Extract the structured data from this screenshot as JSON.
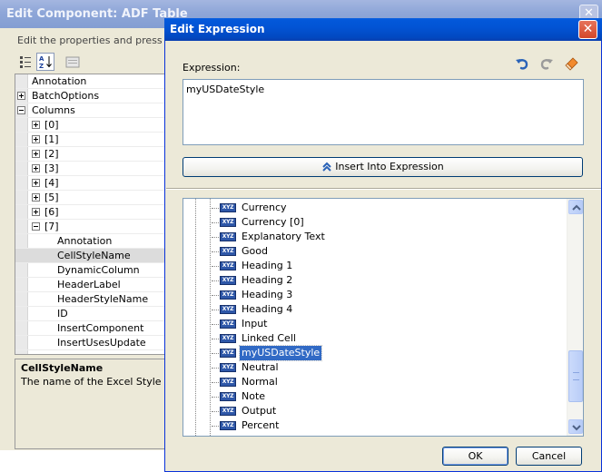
{
  "background_window": {
    "title": "Edit Component: ADF Table",
    "description": "Edit the properties and press OK to",
    "property_rows": [
      {
        "label": "Annotation",
        "indent": 0,
        "toggle": "none"
      },
      {
        "label": "BatchOptions",
        "indent": 0,
        "toggle": "plus"
      },
      {
        "label": "Columns",
        "indent": 0,
        "toggle": "minus"
      },
      {
        "label": "[0]",
        "indent": 1,
        "toggle": "plus"
      },
      {
        "label": "[1]",
        "indent": 1,
        "toggle": "plus"
      },
      {
        "label": "[2]",
        "indent": 1,
        "toggle": "plus"
      },
      {
        "label": "[3]",
        "indent": 1,
        "toggle": "plus"
      },
      {
        "label": "[4]",
        "indent": 1,
        "toggle": "plus"
      },
      {
        "label": "[5]",
        "indent": 1,
        "toggle": "plus"
      },
      {
        "label": "[6]",
        "indent": 1,
        "toggle": "plus"
      },
      {
        "label": "[7]",
        "indent": 1,
        "toggle": "minus"
      },
      {
        "label": "Annotation",
        "indent": 2,
        "toggle": "none"
      },
      {
        "label": "CellStyleName",
        "indent": 2,
        "toggle": "none",
        "selected": true
      },
      {
        "label": "DynamicColumn",
        "indent": 2,
        "toggle": "none"
      },
      {
        "label": "HeaderLabel",
        "indent": 2,
        "toggle": "none"
      },
      {
        "label": "HeaderStyleName",
        "indent": 2,
        "toggle": "none"
      },
      {
        "label": "ID",
        "indent": 2,
        "toggle": "none"
      },
      {
        "label": "InsertComponent",
        "indent": 2,
        "toggle": "none"
      },
      {
        "label": "InsertUsesUpdate",
        "indent": 2,
        "toggle": "none"
      }
    ],
    "info_title": "CellStyleName",
    "info_text": "The name of the Excel Style defin",
    "toolbar_icons": [
      "categorized-icon",
      "alphabetical-sort-icon",
      "property-pages-icon"
    ]
  },
  "dialog": {
    "title": "Edit Expression",
    "expression_label": "Expression:",
    "expression_value": "myUSDateStyle",
    "toolbar_icons": [
      "undo-icon",
      "redo-icon",
      "eraser-icon"
    ],
    "insert_button_label": "Insert Into Expression",
    "badge_text": "XYZ",
    "tree_items": [
      {
        "label": "Currency"
      },
      {
        "label": "Currency [0]"
      },
      {
        "label": "Explanatory Text"
      },
      {
        "label": "Good"
      },
      {
        "label": "Heading 1"
      },
      {
        "label": "Heading 2"
      },
      {
        "label": "Heading 3"
      },
      {
        "label": "Heading 4"
      },
      {
        "label": "Input"
      },
      {
        "label": "Linked Cell"
      },
      {
        "label": "myUSDateStyle",
        "selected": true
      },
      {
        "label": "Neutral"
      },
      {
        "label": "Normal"
      },
      {
        "label": "Note"
      },
      {
        "label": "Output"
      },
      {
        "label": "Percent"
      }
    ],
    "ok_label": "OK",
    "cancel_label": "Cancel"
  },
  "colors": {
    "dialog_titlebar": "#0254d5",
    "selection": "#316ac5",
    "window_face": "#ece9d8"
  }
}
